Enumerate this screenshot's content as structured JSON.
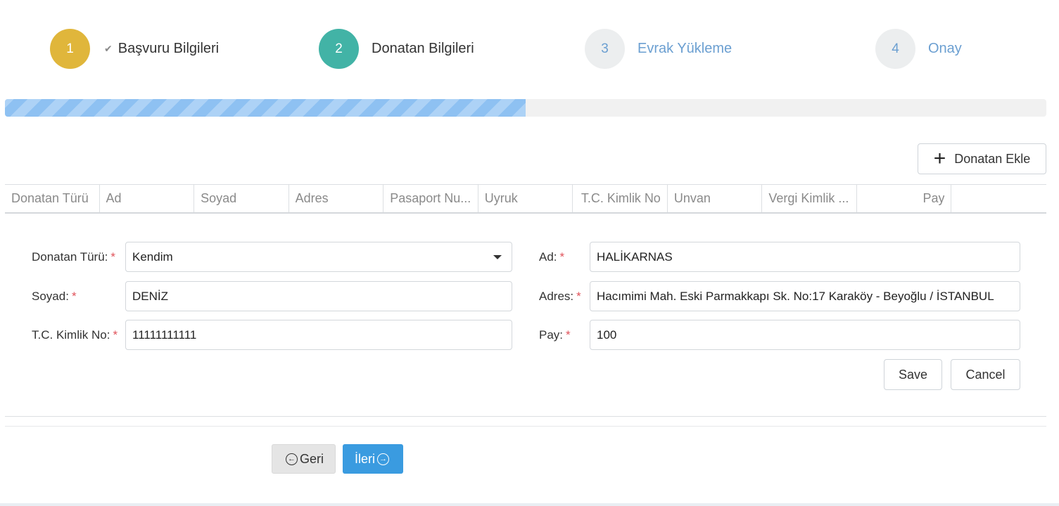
{
  "stepper": {
    "steps": [
      {
        "number": "1",
        "label": "Başvuru Bilgileri",
        "state": "done",
        "check_icon": "check-icon"
      },
      {
        "number": "2",
        "label": "Donatan Bilgileri",
        "state": "active"
      },
      {
        "number": "3",
        "label": "Evrak Yükleme",
        "state": "pending"
      },
      {
        "number": "4",
        "label": "Onay",
        "state": "pending"
      }
    ]
  },
  "progress": {
    "value_percent": 50
  },
  "toolbar": {
    "add_label": "Donatan Ekle",
    "add_icon": "plus-icon"
  },
  "table": {
    "columns": [
      "Donatan Türü",
      "Ad",
      "Soyad",
      "Adres",
      "Pasaport Nu...",
      "Uyruk",
      "T.C. Kimlik No",
      "Unvan",
      "Vergi Kimlik ...",
      "Pay",
      ""
    ]
  },
  "form": {
    "donatan_turu": {
      "label": "Donatan Türü:",
      "required": "*",
      "value": "Kendim"
    },
    "ad": {
      "label": "Ad:",
      "required": "*",
      "value": "HALİKARNAS"
    },
    "soyad": {
      "label": "Soyad:",
      "required": "*",
      "value": "DENİZ"
    },
    "adres": {
      "label": "Adres:",
      "required": "*",
      "value": "Hacımimi Mah. Eski Parmakkapı Sk. No:17 Karaköy - Beyoğlu / İSTANBUL"
    },
    "tc": {
      "label": "T.C. Kimlik No:",
      "required": "*",
      "value": "11111111111"
    },
    "pay": {
      "label": "Pay:",
      "required": "*",
      "value": "100"
    },
    "save_label": "Save",
    "cancel_label": "Cancel"
  },
  "nav": {
    "back_label": "Geri",
    "next_label": "İleri",
    "back_icon": "arrow-left-circle-icon",
    "next_icon": "arrow-right-circle-icon"
  },
  "colors": {
    "step_done": "#e0b63b",
    "step_active": "#42b3a6",
    "step_pending_text": "#6b9fd1",
    "progress_fill": "#8ec1f2",
    "primary_button": "#3a9be0",
    "required_mark": "#e0525a"
  }
}
